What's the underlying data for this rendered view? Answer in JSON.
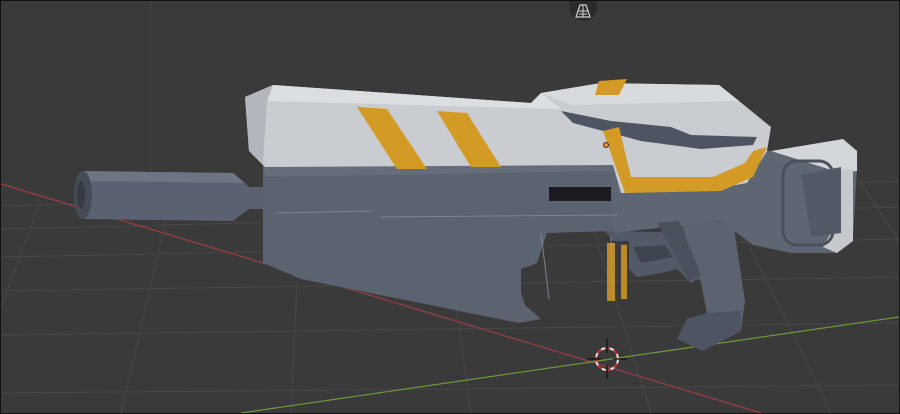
{
  "viewport": {
    "editor": "3D Viewport",
    "background_color": "#3a3a3a",
    "grid_color": "#4a4a4a",
    "axis_x_color": "#9e3c44",
    "axis_y_color": "#6f9a3a"
  },
  "overlays": {
    "navigation_gizmo_icon": "grid-perspective-icon",
    "cursor_icon": "3d-cursor-icon",
    "origin_icon": "object-origin-dot-icon"
  },
  "model": {
    "name": "",
    "body_color": "#5b6270",
    "shell_color": "#c9ccd1",
    "stripe_color": "#d49a26",
    "barrel_color": "#4f5664"
  }
}
